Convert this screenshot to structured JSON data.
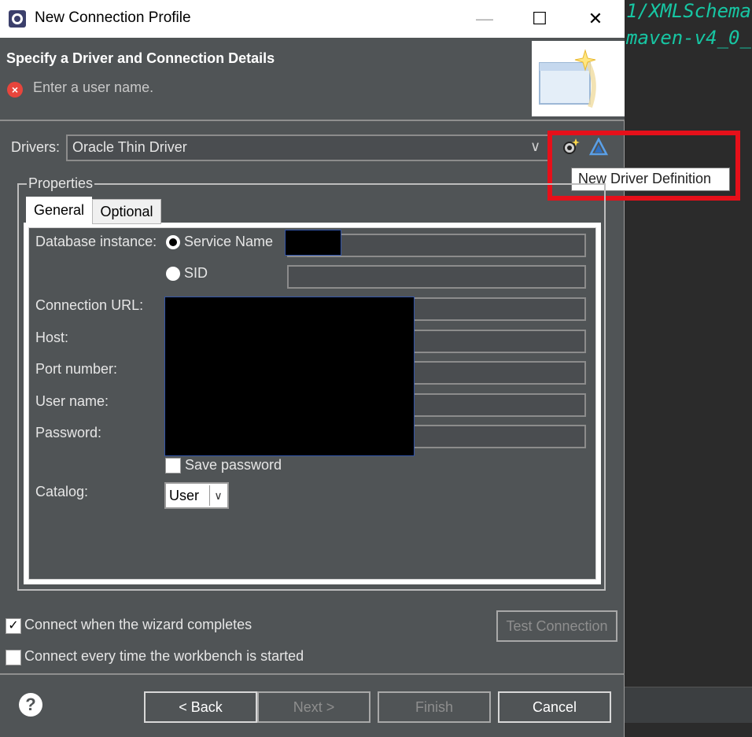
{
  "window": {
    "title": "New Connection Profile"
  },
  "window_controls": {
    "minimize": "—",
    "maximize": "☐",
    "close": "✕"
  },
  "banner": {
    "title": "Specify a Driver and Connection Details",
    "message": "Enter a user name."
  },
  "drivers": {
    "label": "Drivers:",
    "value": "Oracle Thin Driver",
    "tooltip": "New Driver Definition"
  },
  "properties": {
    "group_label": "Properties",
    "tabs": [
      {
        "label": "General",
        "selected": true
      },
      {
        "label": "Optional",
        "selected": false
      }
    ],
    "database_instance_label": "Database instance:",
    "radio_service_name": "Service Name",
    "radio_sid": "SID",
    "connection_url_label": "Connection URL:",
    "host_label": "Host:",
    "port_label": "Port number:",
    "user_name_label": "User name:",
    "password_label": "Password:",
    "save_password": "Save password",
    "catalog_label": "Catalog:",
    "catalog_value": "User"
  },
  "options": {
    "connect_when_complete": "Connect when the wizard completes",
    "connect_every_time": "Connect every time the workbench is started",
    "connect_when_complete_checked": true,
    "connect_every_time_checked": false
  },
  "test_connection": "Test Connection",
  "buttons": {
    "back": "< Back",
    "next": "Next >",
    "finish": "Finish",
    "cancel": "Cancel"
  },
  "editor": {
    "line1": "1/XMLSchema",
    "line2": "maven-v4_0_"
  },
  "colors": {
    "dialog_bg": "#505456",
    "highlight": "#e6101a",
    "editor_text": "#17c6a3",
    "error": "#e8453c"
  }
}
